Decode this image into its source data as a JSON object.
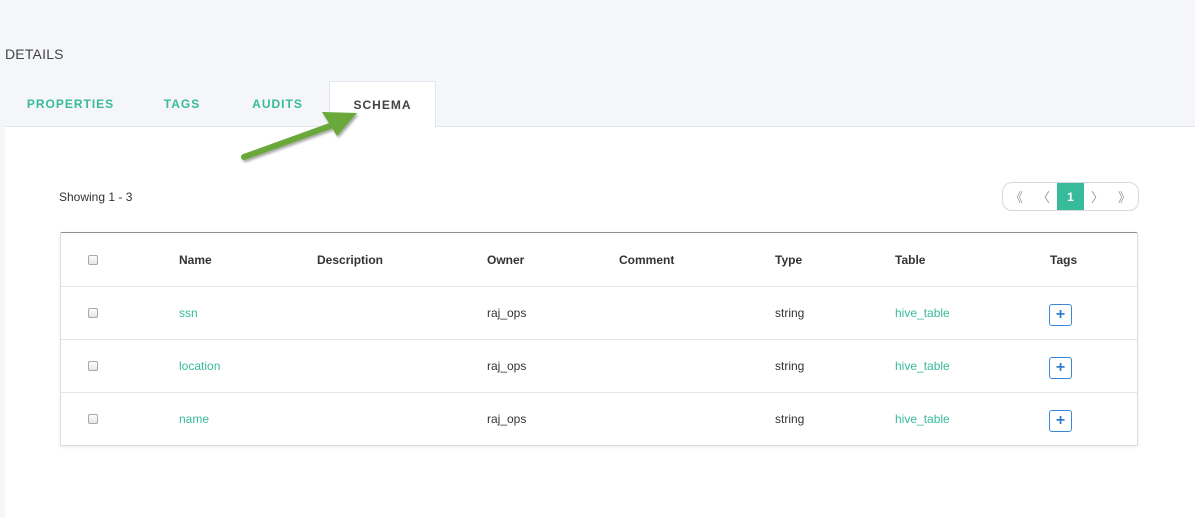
{
  "section": {
    "title": "DETAILS"
  },
  "tabs": [
    {
      "label": "PROPERTIES",
      "active": false
    },
    {
      "label": "TAGS",
      "active": false
    },
    {
      "label": "AUDITS",
      "active": false
    },
    {
      "label": "SCHEMA",
      "active": true
    }
  ],
  "showing": "Showing 1 - 3",
  "pager": {
    "first": "《",
    "prev": "〈",
    "current": "1",
    "next": "〉",
    "last": "》"
  },
  "table": {
    "columns": [
      "Name",
      "Description",
      "Owner",
      "Comment",
      "Type",
      "Table",
      "Tags"
    ],
    "rows": [
      {
        "name": "ssn",
        "description": "",
        "owner": "raj_ops",
        "comment": "",
        "type": "string",
        "table": "hive_table",
        "tag_button": "+"
      },
      {
        "name": "location",
        "description": "",
        "owner": "raj_ops",
        "comment": "",
        "type": "string",
        "table": "hive_table",
        "tag_button": "+"
      },
      {
        "name": "name",
        "description": "",
        "owner": "raj_ops",
        "comment": "",
        "type": "string",
        "table": "hive_table",
        "tag_button": "+"
      }
    ]
  },
  "colors": {
    "accent": "#37bb9b",
    "arrow": "#6aa83a",
    "tag_button": "#3a88d6"
  },
  "annotations": {
    "arrow_icon": "green-arrow-icon pointing to SCHEMA tab"
  }
}
